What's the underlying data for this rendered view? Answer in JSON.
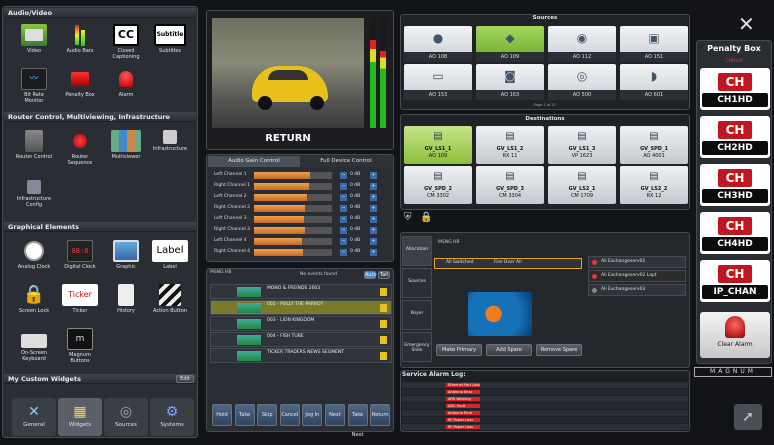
{
  "left": {
    "audio_video": {
      "title": "Audio/Video",
      "items": [
        "Video",
        "Audio Bars",
        "Closed Captioning",
        "Subtitles",
        "Bit Rate Monitor",
        "Penalty Box",
        "Alarm"
      ]
    },
    "router": {
      "title": "Router Control, Multiviewing, Infrastructure",
      "items": [
        "Router Control",
        "Router Sequence",
        "Multiviewer",
        "Infrastructure",
        "Infrastructure Config"
      ]
    },
    "graphical": {
      "title": "Graphical Elements",
      "items": [
        "Analog Clock",
        "Digital Clock",
        "Graphic",
        "Label",
        "Screen Lock",
        "Ticker",
        "History",
        "Action Button",
        "On-Screen Keyboard",
        "Magnum Buttons"
      ],
      "label_text": "Label",
      "ticker_text": "Ticker"
    },
    "custom": {
      "title": "My Custom Widgets",
      "edit": "Edit"
    },
    "tabs": [
      "General",
      "Widgets",
      "Sources",
      "Systems"
    ]
  },
  "video": {
    "caption": "RETURN"
  },
  "audio": {
    "tabs": [
      "Audio Gain Control",
      "Full Device Control"
    ],
    "channels": [
      {
        "name": "Left Channel 1",
        "level": 0.72
      },
      {
        "name": "Right Channel 1",
        "level": 0.7
      },
      {
        "name": "Left Channel 2",
        "level": 0.68
      },
      {
        "name": "Right Channel 2",
        "level": 0.66
      },
      {
        "name": "Left Channel 3",
        "level": 0.64
      },
      {
        "name": "Right Channel 3",
        "level": 0.65
      },
      {
        "name": "Left Channel 4",
        "level": 0.62
      },
      {
        "name": "Right Channel 4",
        "level": 0.63
      }
    ],
    "db": "0 dB"
  },
  "playlist": {
    "title": "MSNG HB",
    "info": "No events found",
    "btns": [
      "Auto",
      "Tail"
    ],
    "events": [
      {
        "title": "MONO & FREINDS 2003",
        "sel": false
      },
      {
        "title": "002 - POLLY THE PARROT",
        "sel": true
      },
      {
        "title": "003 - LION KINGDOM",
        "sel": false
      },
      {
        "title": "004 - FISH TUBE",
        "sel": false
      },
      {
        "title": "TICKER TRADERS NEWS SEGMENT",
        "sel": false
      }
    ],
    "controls": [
      "Hold",
      "Take",
      "Skip",
      "Cancel",
      "Jog In",
      "Next",
      "Take Next",
      "Return"
    ]
  },
  "sources": {
    "title": "Sources",
    "page": "Page 1 of 27",
    "items": [
      "AO 108",
      "AO 109",
      "AO 112",
      "AO 151",
      "AO 153",
      "AO 163",
      "AO 500",
      "AO 601"
    ]
  },
  "destinations": {
    "title": "Destinations",
    "items": [
      {
        "name": "GV_LS1_1",
        "src": "AO 109"
      },
      {
        "name": "GV_LS1_2",
        "src": "RX 11"
      },
      {
        "name": "GV_LS1_3",
        "src": "VP 1623"
      },
      {
        "name": "GV_SPD_1",
        "src": "AO 4001"
      },
      {
        "name": "GV_SPD_2",
        "src": "CM 3302"
      },
      {
        "name": "GV_SPD_3",
        "src": "CM 3304"
      },
      {
        "name": "GV_LS2_1",
        "src": "CM 1709"
      },
      {
        "name": "GV_LS2_2",
        "src": "RX 12"
      }
    ]
  },
  "allocation": {
    "side": [
      "Allocation",
      "Sources",
      "Keyer",
      "Emergency Slide"
    ],
    "title": "MSNG HB",
    "rows": [
      "All Switched",
      "Fire-Over All"
    ],
    "alarms": [
      "Ali Exchangeserv01",
      "Ali Exchangeserv02 Lapt",
      "Ali Exchangeserv03"
    ],
    "buttons": [
      "Make Primary",
      "Add Spare",
      "Remove Spare"
    ]
  },
  "alarm_log": {
    "title": "Service Alarm Log:",
    "rows": [
      "Ethernet Port Loss",
      "Antenna Error",
      "APD Warning",
      "ADC Fault",
      "Antenna Error",
      "RF Power Loss",
      "RF Power Loss"
    ]
  },
  "penalty": {
    "title": "Penalty Box",
    "sub": "Critical",
    "items": [
      "CH1HD",
      "CH2HD",
      "CH3HD",
      "CH4HD",
      "IP_CHAN"
    ],
    "logo": "CH",
    "clear": "Clear Alarm",
    "brand": "MAGNUM"
  }
}
